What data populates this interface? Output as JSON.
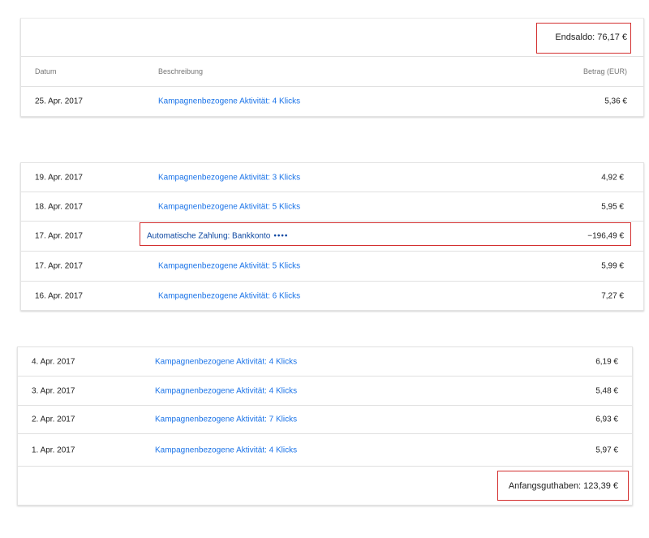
{
  "section_top": {
    "end_balance": "Endsaldo: 76,17 €",
    "headers": {
      "date": "Datum",
      "description": "Beschreibung",
      "amount": "Betrag (EUR)"
    },
    "rows": [
      {
        "date": "25. Apr. 2017",
        "description": "Kampagnenbezogene Aktivität: 4 Klicks",
        "amount": "5,36 €"
      }
    ]
  },
  "section_middle": {
    "rows": [
      {
        "date": "19. Apr. 2017",
        "description": "Kampagnenbezogene Aktivität: 3 Klicks",
        "amount": "4,92 €"
      },
      {
        "date": "18. Apr. 2017",
        "description": "Kampagnenbezogene Aktivität: 5 Klicks",
        "amount": "5,95 €"
      },
      {
        "date": "17. Apr. 2017",
        "description": "Automatische Zahlung: Bankkonto",
        "masked": "••••",
        "amount": "−196,49 €"
      },
      {
        "date": "17. Apr. 2017",
        "description": "Kampagnenbezogene Aktivität: 5 Klicks",
        "amount": "5,99 €"
      },
      {
        "date": "16. Apr. 2017",
        "description": "Kampagnenbezogene Aktivität: 6 Klicks",
        "amount": "7,27 €"
      }
    ]
  },
  "section_bottom": {
    "rows": [
      {
        "date": "4. Apr. 2017",
        "description": "Kampagnenbezogene Aktivität: 4 Klicks",
        "amount": "6,19 €"
      },
      {
        "date": "3. Apr. 2017",
        "description": "Kampagnenbezogene Aktivität: 4 Klicks",
        "amount": "5,48 €"
      },
      {
        "date": "2. Apr. 2017",
        "description": "Kampagnenbezogene Aktivität: 7 Klicks",
        "amount": "6,93 €"
      },
      {
        "date": "1. Apr. 2017",
        "description": "Kampagnenbezogene Aktivität: 4 Klicks",
        "amount": "5,97 €"
      }
    ],
    "start_balance": "Anfangsguthaben: 123,39 €"
  },
  "colors": {
    "link": "#1a73e8",
    "highlight": "#d32f2f",
    "divider": "#e0e0e0"
  }
}
